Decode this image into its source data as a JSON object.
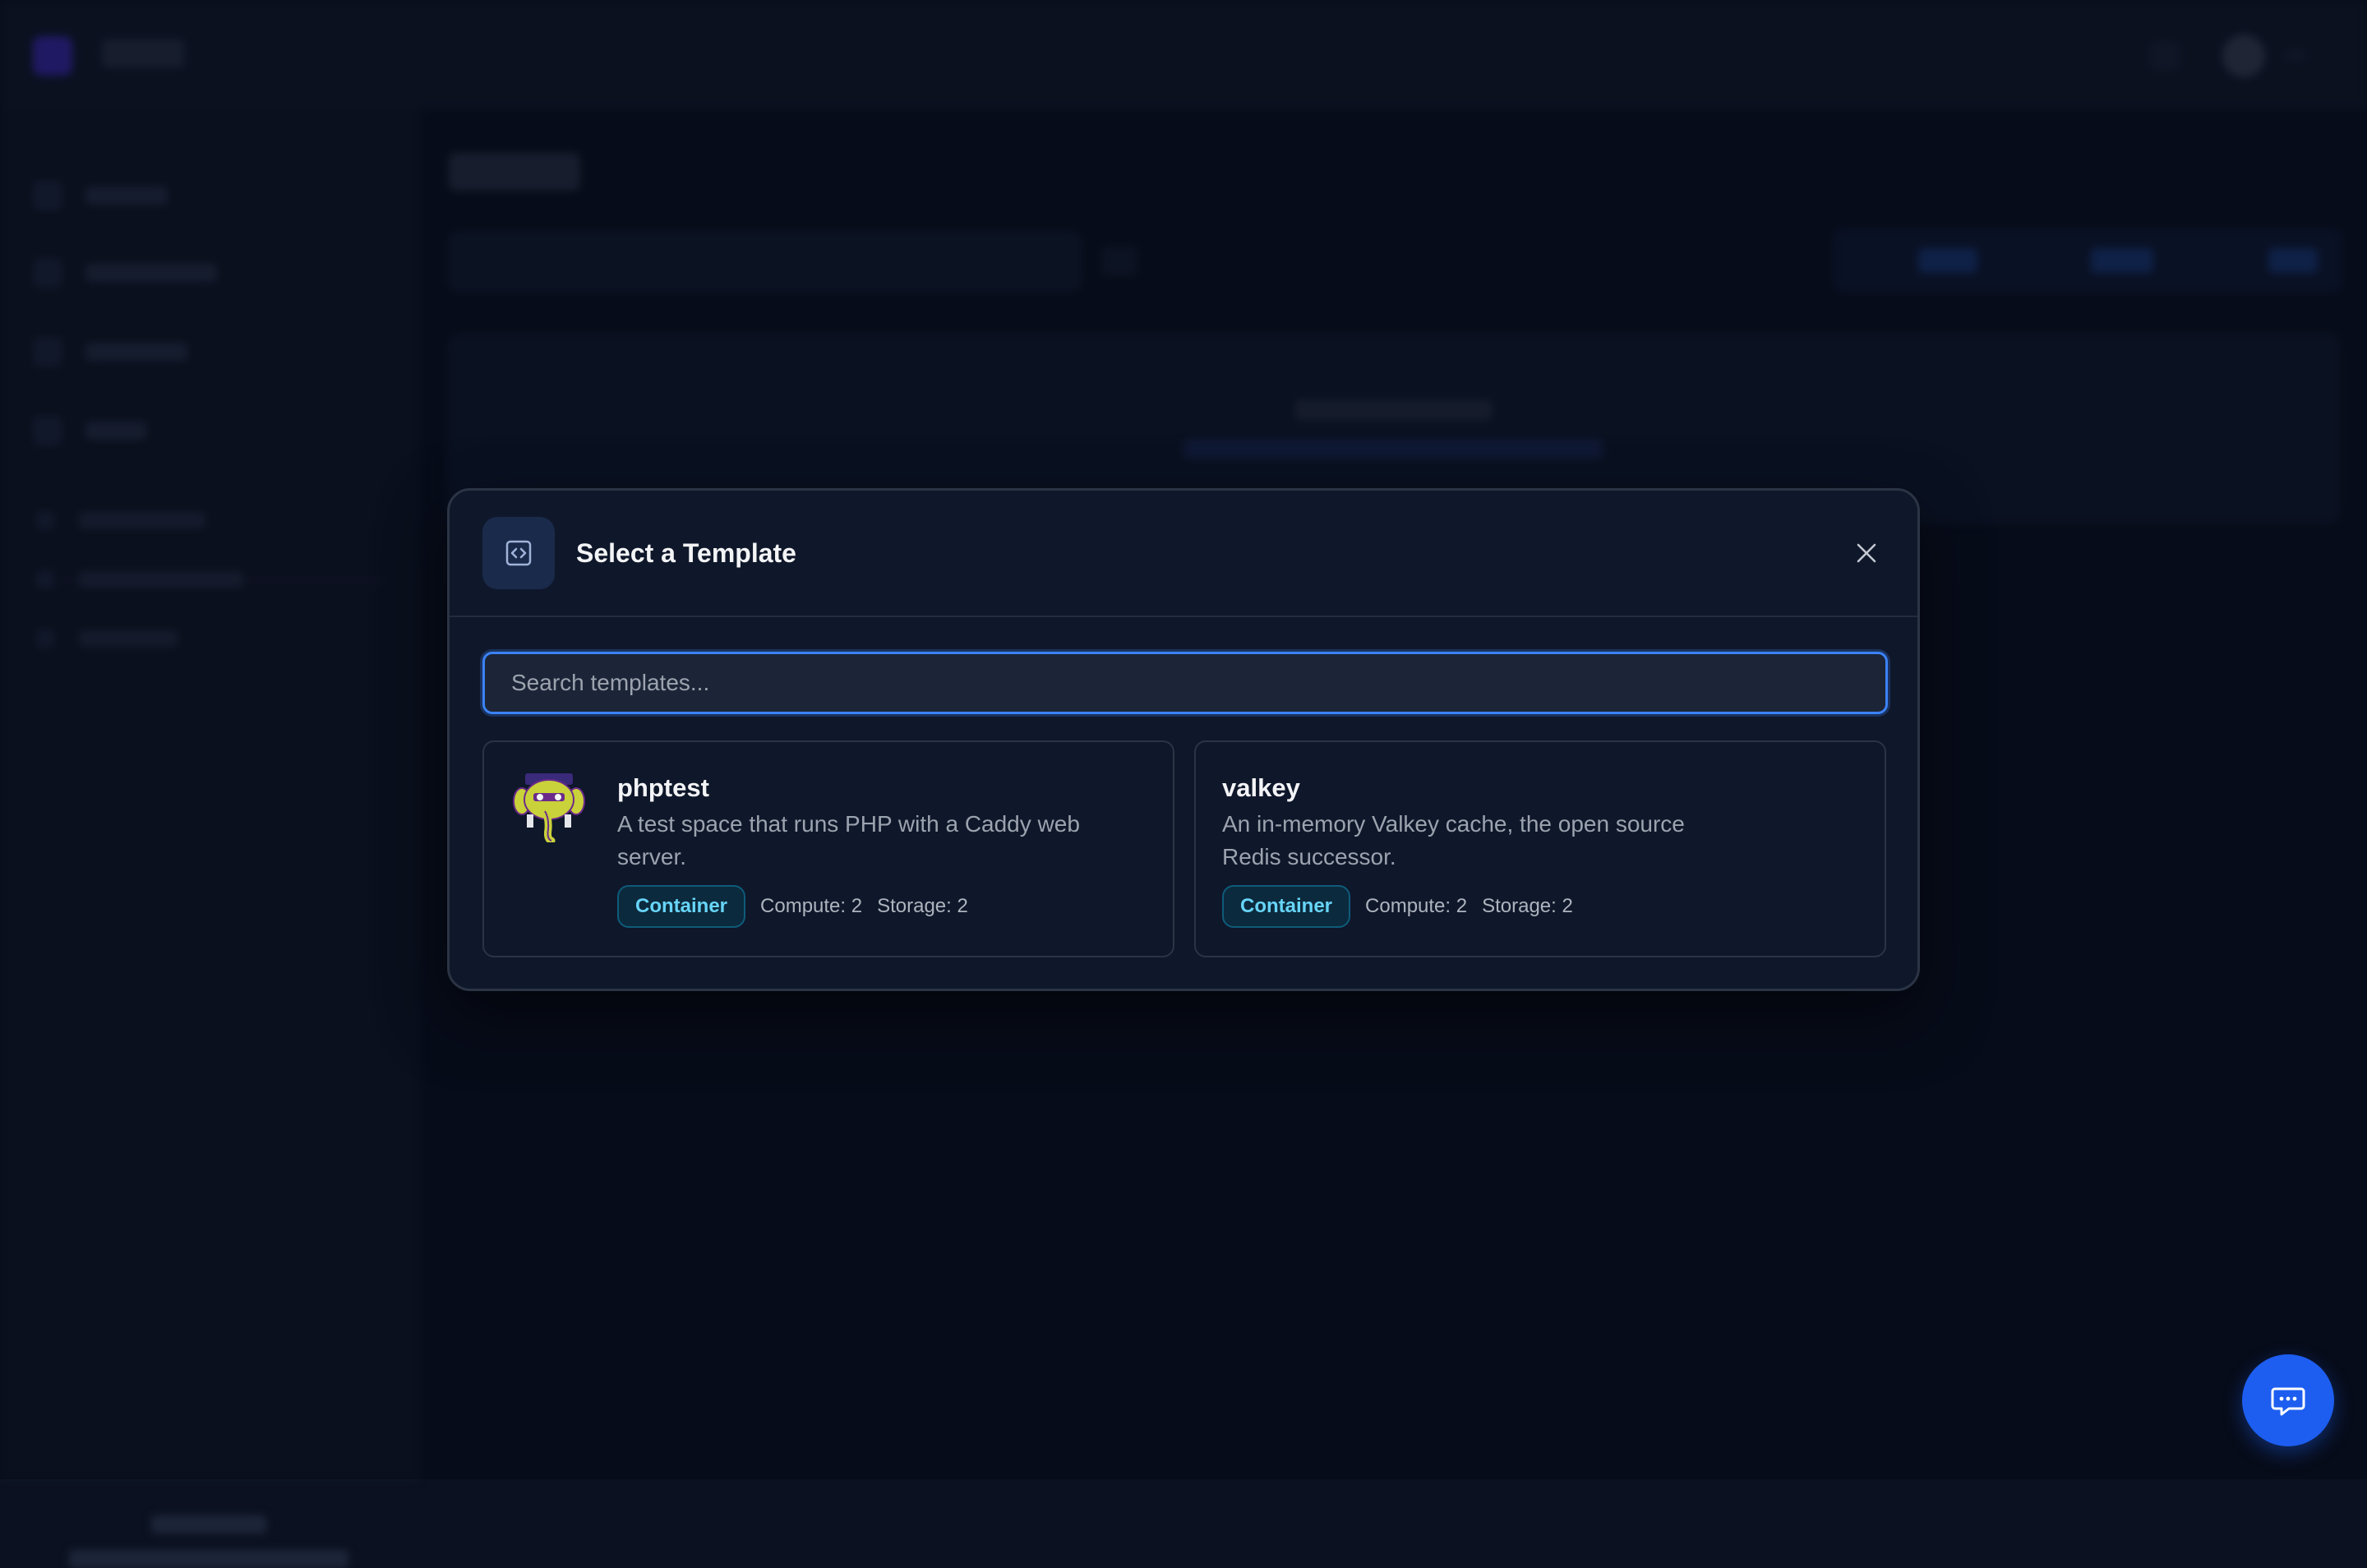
{
  "modal": {
    "title": "Select a Template",
    "icon": "code-bracket-icon",
    "close_icon": "close-icon",
    "search": {
      "placeholder": "Search templates...",
      "value": ""
    }
  },
  "templates": [
    {
      "name": "phptest",
      "description": "A test space that runs PHP with a Caddy web server.",
      "type": "Container",
      "compute": "Compute: 2",
      "storage": "Storage: 2",
      "icon": "php-elephant-logo"
    },
    {
      "name": "valkey",
      "description": "An in-memory Valkey cache, the open source Redis successor.",
      "type": "Container",
      "compute": "Compute: 2",
      "storage": "Storage: 2",
      "icon": ""
    }
  ],
  "chat_button": {
    "icon": "chat-bubble-icon"
  },
  "colors": {
    "accent": "#3b82f6",
    "badge_text": "#67d4f8",
    "chat_button": "#1d5ef0",
    "modal_bg": "#0f172a"
  }
}
